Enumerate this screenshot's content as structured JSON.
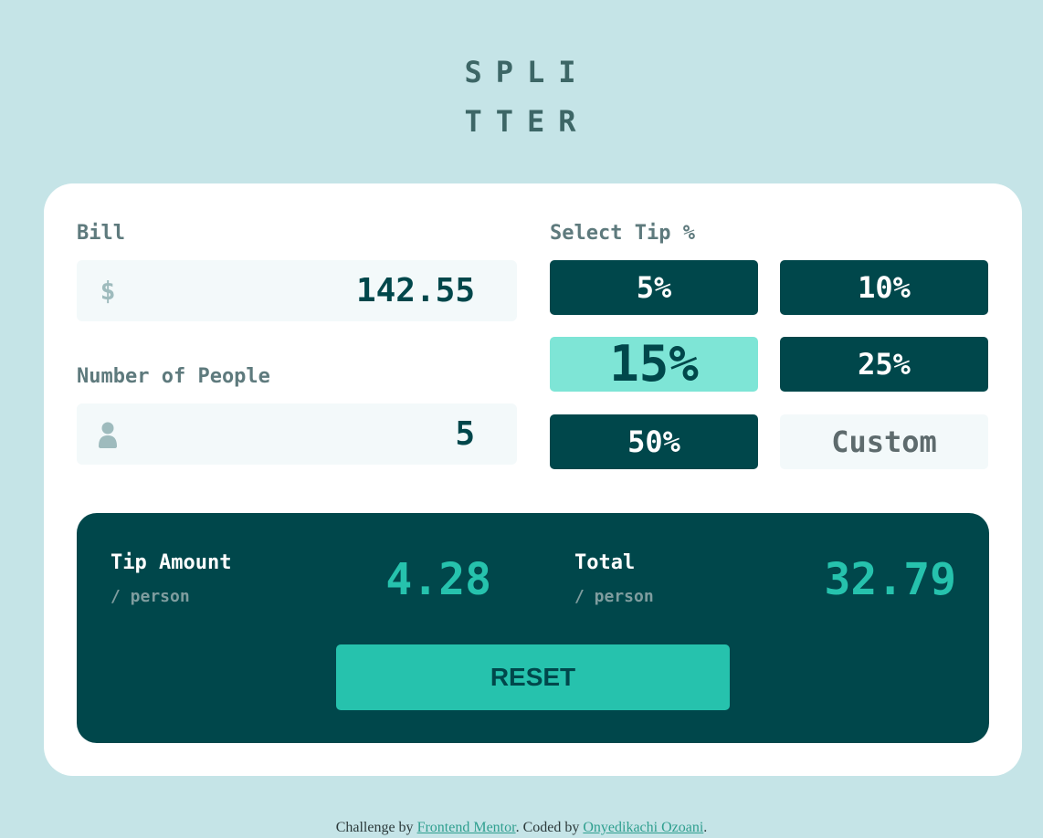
{
  "logo": {
    "line1": "SPLI",
    "line2": "TTER"
  },
  "bill": {
    "label": "Bill",
    "currency_symbol": "$",
    "value": "142.55"
  },
  "people": {
    "label": "Number of People",
    "icon": "person-icon",
    "value": "5"
  },
  "tip": {
    "label": "Select Tip %",
    "options": [
      "5%",
      "10%",
      "15%",
      "25%",
      "50%"
    ],
    "selected": "15%",
    "custom_placeholder": "Custom"
  },
  "result": {
    "tip_amount": {
      "title": "Tip Amount",
      "subtitle": "/ person",
      "value": "4.28"
    },
    "total": {
      "title": "Total",
      "subtitle": "/ person",
      "value": "32.79"
    },
    "reset_label": "RESET"
  },
  "attribution": {
    "prefix": "Challenge by ",
    "mentor_link": "Frontend Mentor",
    "middle": ". Coded by ",
    "author_link": "Onyedikachi Ozoani",
    "suffix": "."
  },
  "colors": {
    "background": "#c5e4e7",
    "dark_cyan": "#00474b",
    "strong_cyan": "#26c2ad",
    "active_tip": "#7ee5d6"
  }
}
